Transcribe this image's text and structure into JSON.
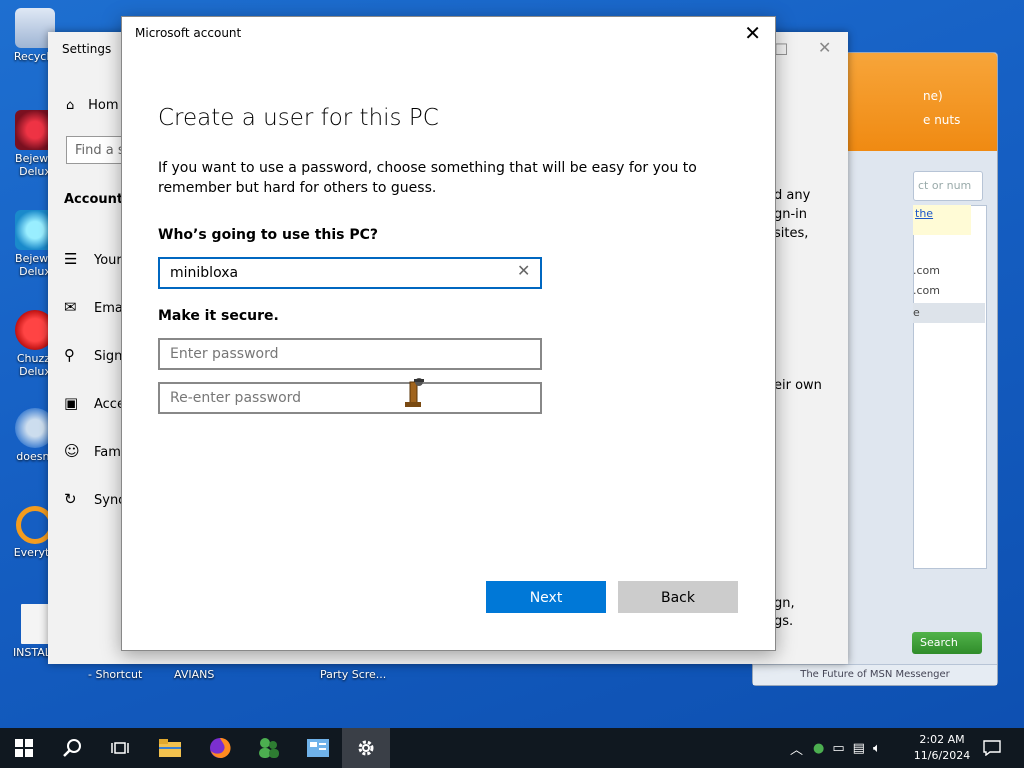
{
  "desktop": {
    "icons": [
      "Recycle",
      "Bejewe Delux",
      "Bejewe Delux",
      "Chuzzl Delux",
      "doesnt",
      "Everyth",
      "INSTALL"
    ],
    "bottom_labels": [
      "- Shortcut",
      "AVIANS",
      "Party Scre..."
    ]
  },
  "msn": {
    "header_line1": "ne)",
    "header_line2": "e nuts",
    "search_placeholder": "ct or num",
    "ad_text": "the",
    "rows": [
      ".com",
      ".com",
      "e"
    ],
    "search_button": "Search",
    "footer": "The Future of MSN Messenger"
  },
  "settings": {
    "title": "Settings",
    "home": "Hom",
    "find_placeholder": "Find a s",
    "section": "Accounts",
    "nav": [
      "Your",
      "Ema",
      "Sign",
      "Acce",
      "Fam",
      "Sync"
    ],
    "right_text": [
      "d any",
      "gn-in",
      "sites,",
      "eir own",
      "gn,",
      "gs."
    ]
  },
  "dialog": {
    "window_title": "Microsoft account",
    "heading": "Create a user for this PC",
    "description": "If you want to use a password, choose something that will be easy for you to remember but hard for others to guess.",
    "who_label": "Who’s going to use this PC?",
    "username_value": "minibloxa",
    "secure_label": "Make it secure.",
    "password_placeholder": "Enter password",
    "reenter_placeholder": "Re-enter password",
    "next_label": "Next",
    "back_label": "Back"
  },
  "taskbar": {
    "time": "2:02 AM",
    "date": "11/6/2024"
  },
  "colors": {
    "accent": "#0078d7",
    "desktop": "#1660c4",
    "taskbar": "#101820"
  }
}
